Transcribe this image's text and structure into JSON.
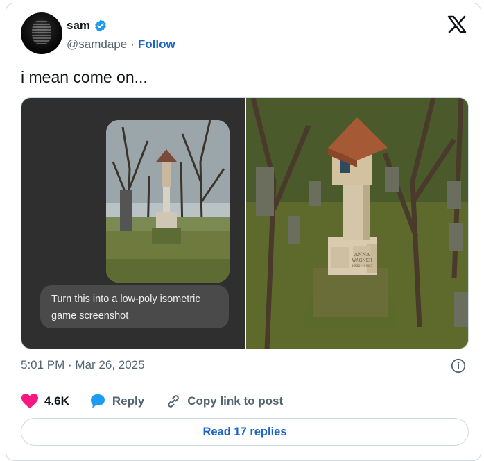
{
  "author": {
    "name": "sam",
    "handle": "@samdape",
    "separator": "·",
    "follow_label": "Follow",
    "verified_color": "#1d9bf0"
  },
  "brand": {
    "logo_icon": "x-logo-icon"
  },
  "tweet": {
    "text": "i mean come on...",
    "timestamp": "5:01 PM · Mar 26, 2025"
  },
  "media": {
    "prompt_text": "Turn this into a low-poly isometric game screenshot",
    "rendered_sign": {
      "line1": "ANNA",
      "line2": "WAGNER",
      "line3": "1902 - 1985"
    }
  },
  "actions": {
    "likes_count": "4.6K",
    "reply_label": "Reply",
    "copy_link_label": "Copy link to post",
    "read_replies_label": "Read 17 replies",
    "like_color": "#f91880",
    "reply_color": "#1d9bf0"
  }
}
